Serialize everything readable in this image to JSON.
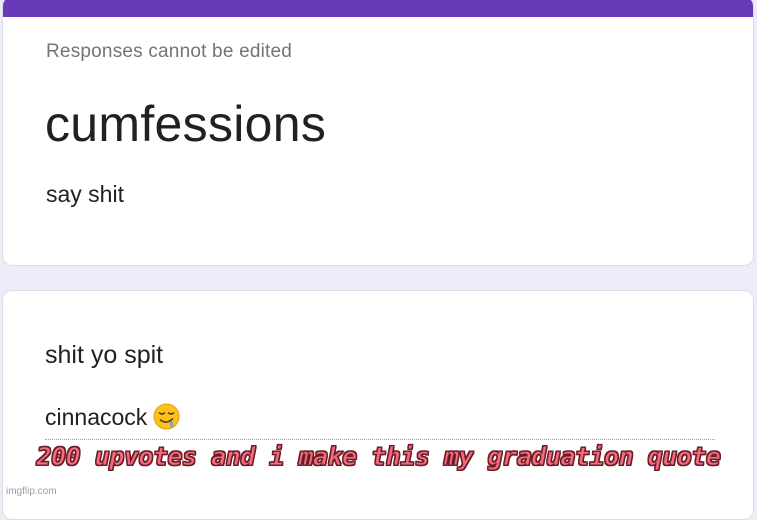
{
  "form": {
    "notice": "Responses cannot be edited",
    "title": "cumfessions",
    "description": "say shit",
    "accent_color": "#673ab7"
  },
  "question": {
    "title": "shit yo spit",
    "answer": "cinnacock",
    "answer_emoji_icon": "drooling-face-emoji"
  },
  "overlay": {
    "caption": "200 upvotes and i make this my graduation quote",
    "caption_color": "#f26d7d"
  },
  "watermark": "imgflip.com"
}
